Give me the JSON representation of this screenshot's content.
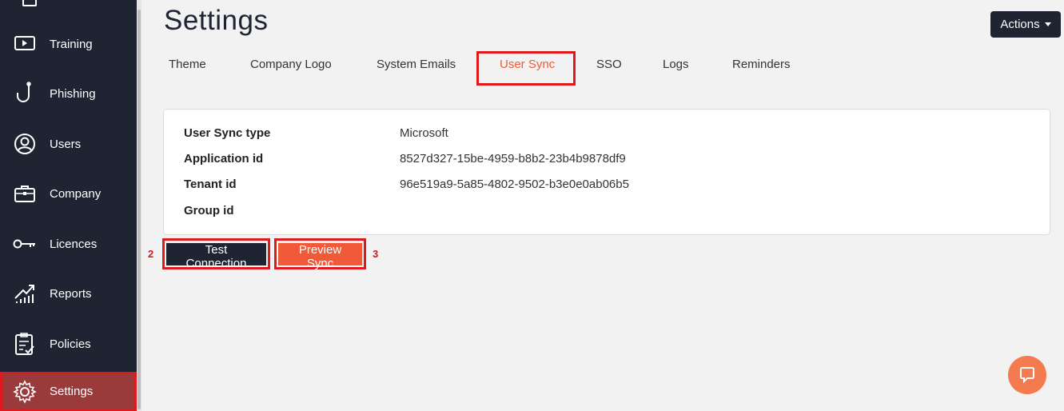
{
  "sidebar": {
    "items": [
      {
        "label": "Training",
        "icon": "play-icon"
      },
      {
        "label": "Phishing",
        "icon": "hook-icon"
      },
      {
        "label": "Users",
        "icon": "user-icon"
      },
      {
        "label": "Company",
        "icon": "briefcase-icon"
      },
      {
        "label": "Licences",
        "icon": "key-icon"
      },
      {
        "label": "Reports",
        "icon": "chart-icon"
      },
      {
        "label": "Policies",
        "icon": "clipboard-icon"
      },
      {
        "label": "Settings",
        "icon": "gear-icon",
        "active": true
      }
    ]
  },
  "page": {
    "title": "Settings"
  },
  "actions": {
    "label": "Actions"
  },
  "tabs": [
    {
      "label": "Theme"
    },
    {
      "label": "Company Logo"
    },
    {
      "label": "System Emails"
    },
    {
      "label": "User Sync",
      "active": true
    },
    {
      "label": "SSO"
    },
    {
      "label": "Logs"
    },
    {
      "label": "Reminders"
    }
  ],
  "details": [
    {
      "key": "User Sync type",
      "value": "Microsoft"
    },
    {
      "key": "Application id",
      "value": "8527d327-15be-4959-b8b2-23b4b9878df9"
    },
    {
      "key": "Tenant id",
      "value": "96e519a9-5a85-4802-9502-b3e0e0ab06b5"
    },
    {
      "key": "Group id",
      "value": ""
    }
  ],
  "buttons": {
    "test_connection": "Test Connection",
    "preview_sync": "Preview Sync"
  },
  "annotations": {
    "step2": "2",
    "step3": "3"
  },
  "colors": {
    "accent": "#f05a38",
    "dark": "#1f2433",
    "highlight": "#e0191d"
  }
}
